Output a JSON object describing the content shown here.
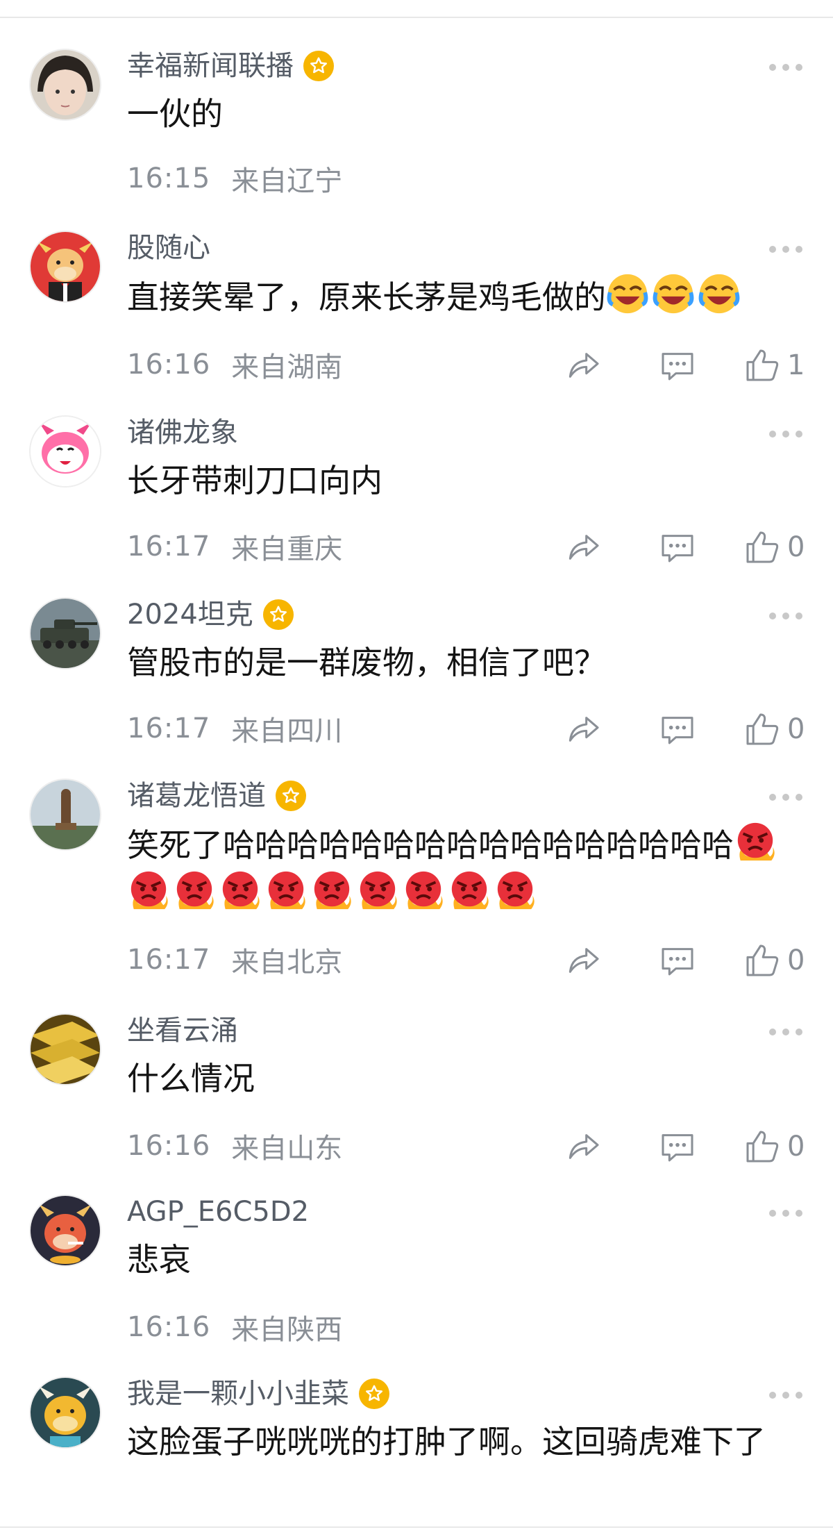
{
  "comments": [
    {
      "username": "幸福新闻联播",
      "verified": true,
      "text": "一伙的",
      "emoji": "",
      "emoji_count": 0,
      "time": "16:15",
      "location": "来自辽宁",
      "likes": null,
      "avatar": "girl-photo"
    },
    {
      "username": "股随心",
      "verified": false,
      "text": "直接笑晕了，原来长茅是鸡毛做的",
      "emoji": "crying-laughing-emoji",
      "emoji_count": 3,
      "time": "16:16",
      "location": "来自湖南",
      "likes": "1",
      "avatar": "red-bull-cartoon"
    },
    {
      "username": "诸佛龙象",
      "verified": false,
      "text": "长牙带刺刀口向内",
      "emoji": "",
      "emoji_count": 0,
      "time": "16:17",
      "location": "来自重庆",
      "likes": "0",
      "avatar": "pink-bull-cartoon"
    },
    {
      "username": "2024坦克",
      "verified": true,
      "text": "管股市的是一群废物，相信了吧？",
      "emoji": "",
      "emoji_count": 0,
      "time": "16:17",
      "location": "来自四川",
      "likes": "0",
      "avatar": "tank-photo"
    },
    {
      "username": "诸葛龙悟道",
      "verified": true,
      "text": "笑死了哈哈哈哈哈哈哈哈哈哈哈哈哈哈哈哈",
      "emoji": "angry-face-emoji",
      "emoji_count": 10,
      "time": "16:17",
      "location": "来自北京",
      "likes": "0",
      "avatar": "statue-photo"
    },
    {
      "username": "坐看云涌",
      "verified": false,
      "text": "什么情况",
      "emoji": "",
      "emoji_count": 0,
      "time": "16:16",
      "location": "来自山东",
      "likes": "0",
      "avatar": "gold-bars-photo"
    },
    {
      "username": "AGP_E6C5D2",
      "verified": false,
      "text": "悲哀",
      "emoji": "",
      "emoji_count": 0,
      "time": "16:16",
      "location": "来自陕西",
      "likes": null,
      "avatar": "bull-smoking-cartoon"
    },
    {
      "username": "我是一颗小小韭菜",
      "verified": true,
      "text": "这脸蛋子咣咣咣的打肿了啊。这回骑虎难下了",
      "emoji": "",
      "emoji_count": 0,
      "time": "",
      "location": "",
      "likes": null,
      "avatar": "yellow-bull-cartoon"
    }
  ],
  "colors": {
    "badge": "#f7b500",
    "meta": "#8a8f96",
    "username": "#555c66"
  }
}
